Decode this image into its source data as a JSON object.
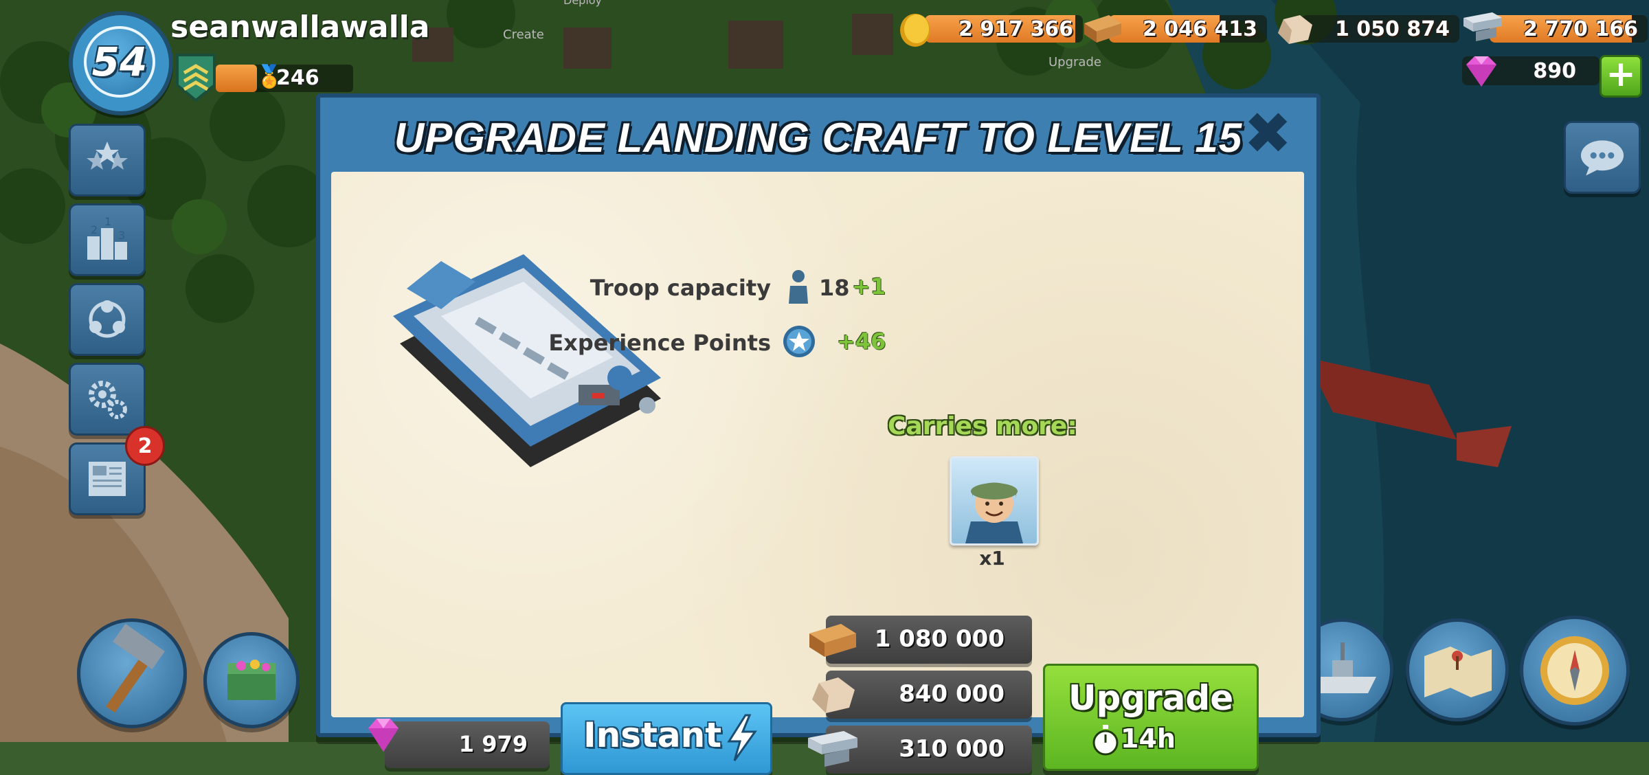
{
  "player": {
    "level": "54",
    "name": "seanwallawalla",
    "medals": "246",
    "medal_progress": 0.3
  },
  "resources": {
    "gold": {
      "value": "2 917 366",
      "fill": 0.95
    },
    "wood": {
      "value": "2 046 413",
      "fill": 0.7
    },
    "stone": {
      "value": "1 050 874",
      "fill": 0.0
    },
    "iron": {
      "value": "2 770 166",
      "fill": 0.9
    },
    "diamonds": "890"
  },
  "sidebar": {
    "notification_count": "2",
    "items": [
      "star-icon",
      "leaderboard-icon",
      "task-force-icon",
      "settings-icon",
      "newspaper-icon"
    ]
  },
  "map_labels": {
    "create": "Create",
    "deploy": "Deploy",
    "upgrade": "Upgrade"
  },
  "modal": {
    "title": "UPGRADE LANDING CRAFT TO LEVEL 15",
    "stats": [
      {
        "label": "Troop capacity",
        "value": "18",
        "bonus": "+1",
        "icon": "troop-icon"
      },
      {
        "label": "Experience Points",
        "value": "",
        "bonus": "+46",
        "icon": "xp-star-icon"
      }
    ],
    "carries_label": "Carries more:",
    "unit_count": "x1",
    "costs": {
      "wood": "1 080 000",
      "stone": "840 000",
      "iron": "310 000"
    },
    "gem_cost": "1 979",
    "instant_label": "Instant",
    "upgrade_label": "Upgrade",
    "upgrade_time": "14h"
  },
  "colors": {
    "modal_blue": "#3d7fb0",
    "paper": "#f4ebd3",
    "upgrade_green": "#5cb622",
    "instant_blue": "#2f97d3",
    "bonus_green": "#7ec43a",
    "bar_orange": "#e07a25"
  }
}
